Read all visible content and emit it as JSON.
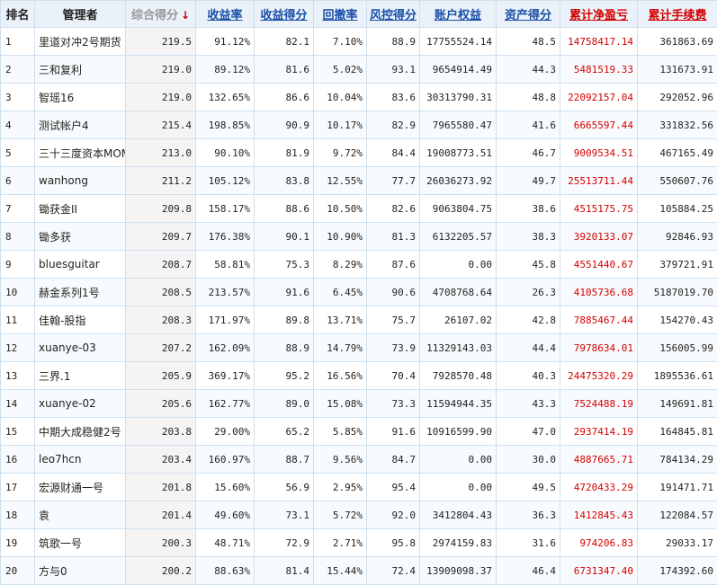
{
  "headers": {
    "rank": "排名",
    "manager": "管理者",
    "composite": "综合得分",
    "return_rate": "收益率",
    "return_score": "收益得分",
    "drawdown": "回撤率",
    "risk_score": "风控得分",
    "equity": "账户权益",
    "asset_score": "资产得分",
    "net_pnl": "累计净盈亏",
    "fees": "累计手续费"
  },
  "sort_icon": "down-arrow-icon",
  "colors": {
    "header_bg": "#eaf1f8",
    "link": "#1a4fa8",
    "negative": "#d40000",
    "border": "#cfe0ee"
  },
  "rows": [
    {
      "rank": "1",
      "manager": "里道对冲2号期货",
      "composite": "219.5",
      "return_rate": "91.12%",
      "return_score": "82.1",
      "drawdown": "7.10%",
      "risk_score": "88.9",
      "equity": "17755524.14",
      "asset_score": "48.5",
      "net_pnl": "14758417.14",
      "fees": "361863.69"
    },
    {
      "rank": "2",
      "manager": "三和复利",
      "composite": "219.0",
      "return_rate": "89.12%",
      "return_score": "81.6",
      "drawdown": "5.02%",
      "risk_score": "93.1",
      "equity": "9654914.49",
      "asset_score": "44.3",
      "net_pnl": "5481519.33",
      "fees": "131673.91"
    },
    {
      "rank": "3",
      "manager": "智瑶16",
      "composite": "219.0",
      "return_rate": "132.65%",
      "return_score": "86.6",
      "drawdown": "10.04%",
      "risk_score": "83.6",
      "equity": "30313790.31",
      "asset_score": "48.8",
      "net_pnl": "22092157.04",
      "fees": "292052.96"
    },
    {
      "rank": "4",
      "manager": "测试帐户4",
      "composite": "215.4",
      "return_rate": "198.85%",
      "return_score": "90.9",
      "drawdown": "10.17%",
      "risk_score": "82.9",
      "equity": "7965580.47",
      "asset_score": "41.6",
      "net_pnl": "6665597.44",
      "fees": "331832.56"
    },
    {
      "rank": "5",
      "manager": "三十三度资本MOM",
      "composite": "213.0",
      "return_rate": "90.10%",
      "return_score": "81.9",
      "drawdown": "9.72%",
      "risk_score": "84.4",
      "equity": "19008773.51",
      "asset_score": "46.7",
      "net_pnl": "9009534.51",
      "fees": "467165.49"
    },
    {
      "rank": "6",
      "manager": "wanhong",
      "composite": "211.2",
      "return_rate": "105.12%",
      "return_score": "83.8",
      "drawdown": "12.55%",
      "risk_score": "77.7",
      "equity": "26036273.92",
      "asset_score": "49.7",
      "net_pnl": "25513711.44",
      "fees": "550607.76"
    },
    {
      "rank": "7",
      "manager": "锄获金II",
      "composite": "209.8",
      "return_rate": "158.17%",
      "return_score": "88.6",
      "drawdown": "10.50%",
      "risk_score": "82.6",
      "equity": "9063804.75",
      "asset_score": "38.6",
      "net_pnl": "4515175.75",
      "fees": "105884.25"
    },
    {
      "rank": "8",
      "manager": "锄多获",
      "composite": "209.7",
      "return_rate": "176.38%",
      "return_score": "90.1",
      "drawdown": "10.90%",
      "risk_score": "81.3",
      "equity": "6132205.57",
      "asset_score": "38.3",
      "net_pnl": "3920133.07",
      "fees": "92846.93"
    },
    {
      "rank": "9",
      "manager": "bluesguitar",
      "composite": "208.7",
      "return_rate": "58.81%",
      "return_score": "75.3",
      "drawdown": "8.29%",
      "risk_score": "87.6",
      "equity": "0.00",
      "asset_score": "45.8",
      "net_pnl": "4551440.67",
      "fees": "379721.91"
    },
    {
      "rank": "10",
      "manager": "赫金系列1号",
      "composite": "208.5",
      "return_rate": "213.57%",
      "return_score": "91.6",
      "drawdown": "6.45%",
      "risk_score": "90.6",
      "equity": "4708768.64",
      "asset_score": "26.3",
      "net_pnl": "4105736.68",
      "fees": "5187019.70"
    },
    {
      "rank": "11",
      "manager": "佳翰-股指",
      "composite": "208.3",
      "return_rate": "171.97%",
      "return_score": "89.8",
      "drawdown": "13.71%",
      "risk_score": "75.7",
      "equity": "26107.02",
      "asset_score": "42.8",
      "net_pnl": "7885467.44",
      "fees": "154270.43"
    },
    {
      "rank": "12",
      "manager": "xuanye-03",
      "composite": "207.2",
      "return_rate": "162.09%",
      "return_score": "88.9",
      "drawdown": "14.79%",
      "risk_score": "73.9",
      "equity": "11329143.03",
      "asset_score": "44.4",
      "net_pnl": "7978634.01",
      "fees": "156005.99"
    },
    {
      "rank": "13",
      "manager": "三界.1",
      "composite": "205.9",
      "return_rate": "369.17%",
      "return_score": "95.2",
      "drawdown": "16.56%",
      "risk_score": "70.4",
      "equity": "7928570.48",
      "asset_score": "40.3",
      "net_pnl": "24475320.29",
      "fees": "1895536.61"
    },
    {
      "rank": "14",
      "manager": "xuanye-02",
      "composite": "205.6",
      "return_rate": "162.77%",
      "return_score": "89.0",
      "drawdown": "15.08%",
      "risk_score": "73.3",
      "equity": "11594944.35",
      "asset_score": "43.3",
      "net_pnl": "7524488.19",
      "fees": "149691.81"
    },
    {
      "rank": "15",
      "manager": "中期大成稳健2号",
      "composite": "203.8",
      "return_rate": "29.00%",
      "return_score": "65.2",
      "drawdown": "5.85%",
      "risk_score": "91.6",
      "equity": "10916599.90",
      "asset_score": "47.0",
      "net_pnl": "2937414.19",
      "fees": "164845.81"
    },
    {
      "rank": "16",
      "manager": "leo7hcn",
      "composite": "203.4",
      "return_rate": "160.97%",
      "return_score": "88.7",
      "drawdown": "9.56%",
      "risk_score": "84.7",
      "equity": "0.00",
      "asset_score": "30.0",
      "net_pnl": "4887665.71",
      "fees": "784134.29"
    },
    {
      "rank": "17",
      "manager": "宏源财通一号",
      "composite": "201.8",
      "return_rate": "15.60%",
      "return_score": "56.9",
      "drawdown": "2.95%",
      "risk_score": "95.4",
      "equity": "0.00",
      "asset_score": "49.5",
      "net_pnl": "4720433.29",
      "fees": "191471.71"
    },
    {
      "rank": "18",
      "manager": "袁",
      "composite": "201.4",
      "return_rate": "49.60%",
      "return_score": "73.1",
      "drawdown": "5.72%",
      "risk_score": "92.0",
      "equity": "3412804.43",
      "asset_score": "36.3",
      "net_pnl": "1412845.43",
      "fees": "122084.57"
    },
    {
      "rank": "19",
      "manager": "筑歌一号",
      "composite": "200.3",
      "return_rate": "48.71%",
      "return_score": "72.9",
      "drawdown": "2.71%",
      "risk_score": "95.8",
      "equity": "2974159.83",
      "asset_score": "31.6",
      "net_pnl": "974206.83",
      "fees": "29033.17"
    },
    {
      "rank": "20",
      "manager": "方与0",
      "composite": "200.2",
      "return_rate": "88.63%",
      "return_score": "81.4",
      "drawdown": "15.44%",
      "risk_score": "72.4",
      "equity": "13909098.37",
      "asset_score": "46.4",
      "net_pnl": "6731347.40",
      "fees": "174392.60"
    }
  ]
}
